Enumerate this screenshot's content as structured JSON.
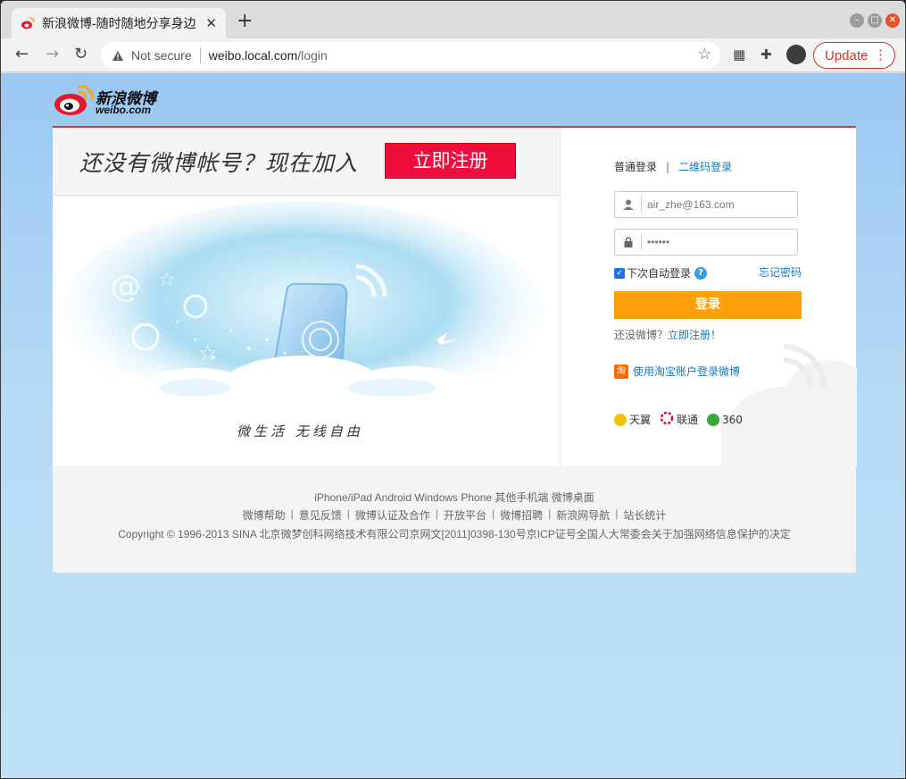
{
  "browser": {
    "tab_title": "新浪微博-随时随地分享身边",
    "tab_close": "✕",
    "new_tab": "+",
    "not_secure": "Not secure",
    "url_host": "weibo.local.com",
    "url_path": "/login",
    "update_label": "Update"
  },
  "logo": {
    "cn": "新浪微博",
    "en": "weibo.com"
  },
  "banner": {
    "headline": "还没有微博帐号？现在加入",
    "register_label": "立即注册"
  },
  "illustration": {
    "slogan": "微生活  无线自由"
  },
  "login": {
    "tab_normal": "普通登录",
    "tab_divider": "|",
    "tab_qr": "二维码登录",
    "username_value": "air_zhe@163.com",
    "password_value": "••••••",
    "remember_label": "下次自动登录",
    "help": "?",
    "forgot_label": "忘记密码",
    "submit_label": "登录",
    "no_account_text": "还没微博？",
    "no_account_link": "立即注册！",
    "taobao_icon": "淘",
    "taobao_label": "使用淘宝账户登录微博",
    "partners": [
      "天翼",
      "联通",
      "360"
    ]
  },
  "footer": {
    "row1": "iPhone/iPad Android Windows Phone 其他手机端 微博桌面",
    "links": [
      "微博帮助",
      "意见反馈",
      "微博认证及合作",
      "开放平台",
      "微博招聘",
      "新浪网导航",
      "站长统计"
    ],
    "copyright": "Copyright © 1996-2013 SINA 北京微梦创科网络技术有限公司京网文[2011]0398-130号京ICP证号全国人大常委会关于加强网络信息保护的决定"
  },
  "colors": {
    "accent_red": "#ee0d3c",
    "login_orange": "#ffa00a",
    "link_blue": "#0b7bc1"
  }
}
